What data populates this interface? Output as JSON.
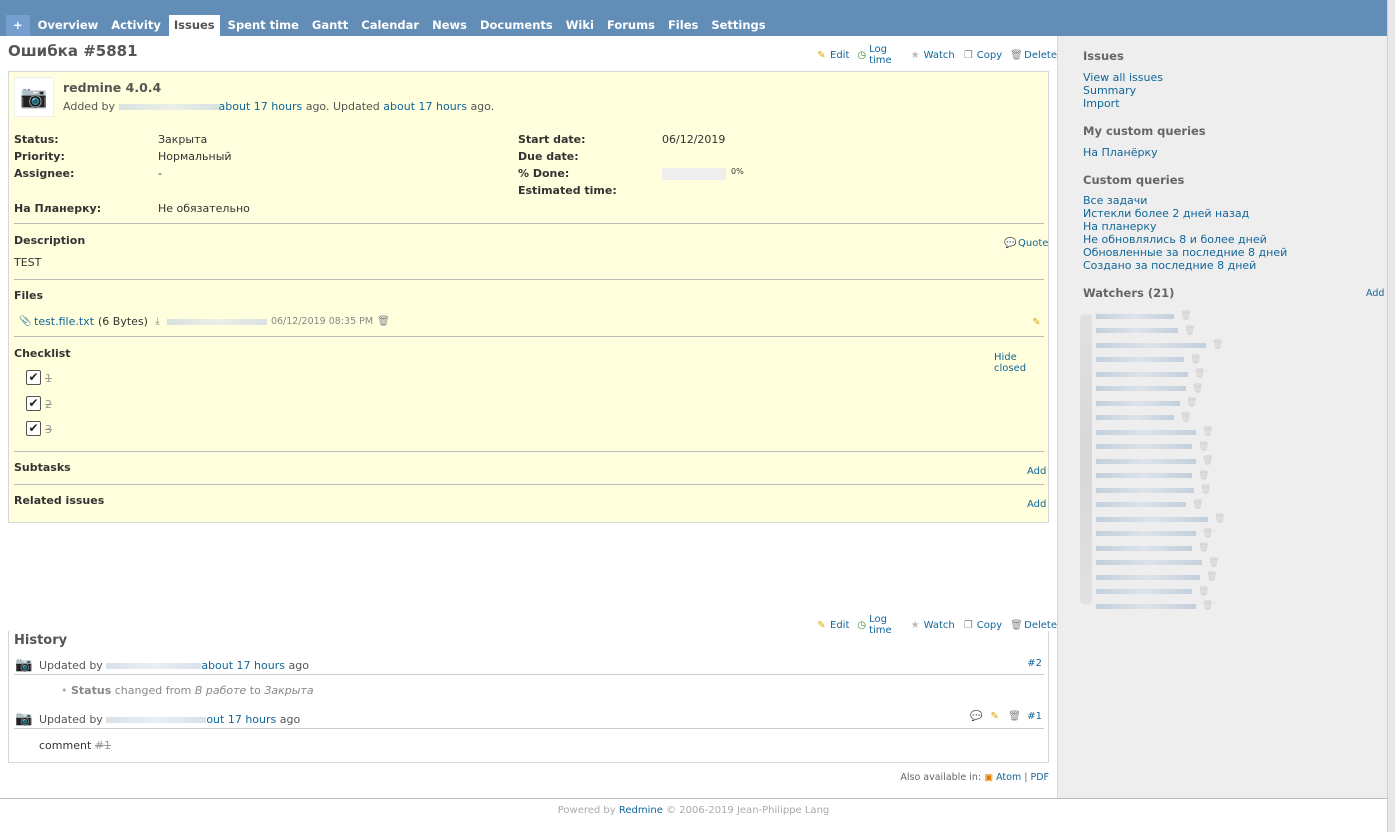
{
  "tabs": {
    "plus": "+",
    "items": [
      "Overview",
      "Activity",
      "Issues",
      "Spent time",
      "Gantt",
      "Calendar",
      "News",
      "Documents",
      "Wiki",
      "Forums",
      "Files",
      "Settings"
    ],
    "selected": "Issues"
  },
  "issue": {
    "title": "Ошибка #5881",
    "subject": "redmine 4.0.4",
    "added_by_prefix": "Added by",
    "added_ago": "about 17 hours",
    "updated_mid": "ago. Updated",
    "updated_ago": "about 17 hours",
    "ago_suffix": "ago.",
    "contextual": {
      "edit": "Edit",
      "log_time": "Log time",
      "watch": "Watch",
      "copy": "Copy",
      "delete": "Delete"
    },
    "attributes": {
      "status_label": "Status:",
      "status": "Закрыта",
      "priority_label": "Priority:",
      "priority": "Нормальный",
      "assignee_label": "Assignee:",
      "assignee": "-",
      "planerka_label": "На Планерку:",
      "planerka": "Не обязательно",
      "start_label": "Start date:",
      "start": "06/12/2019",
      "due_label": "Due date:",
      "due": "",
      "done_label": "% Done:",
      "done": "0%",
      "done_fraction": 0,
      "estimated_label": "Estimated time:",
      "estimated": ""
    },
    "description": {
      "heading": "Description",
      "quote": "Quote",
      "text": "TEST"
    },
    "files": {
      "heading": "Files",
      "name": "test.file.txt",
      "size": "(6 Bytes)",
      "date": "06/12/2019 08:35 PM"
    },
    "checklist": {
      "heading": "Checklist",
      "hide_closed": "Hide closed",
      "items": [
        "1",
        "2",
        "3"
      ]
    },
    "subtasks": {
      "heading": "Subtasks",
      "add": "Add"
    },
    "related": {
      "heading": "Related issues",
      "add": "Add"
    }
  },
  "history": {
    "title": "History",
    "journals": [
      {
        "prefix": "Updated by",
        "ago": "about 17 hours",
        "suffix": "ago",
        "num": "#2",
        "detail_field": "Status",
        "detail_mid": "changed from",
        "detail_old": "В работе",
        "detail_to": "to",
        "detail_new": "Закрыта"
      },
      {
        "prefix": "Updated by",
        "ago": "out 17 hours",
        "suffix": "ago",
        "num": "#1",
        "comment": "comment",
        "comment_ref": "#1"
      }
    ]
  },
  "also_available": {
    "label": "Also available in:",
    "atom": "Atom",
    "sep": "|",
    "pdf": "PDF"
  },
  "footer": {
    "powered": "Powered by",
    "redmine": "Redmine",
    "copyright": "© 2006-2019 Jean-Philippe Lang"
  },
  "sidebar": {
    "issues_heading": "Issues",
    "issue_links": [
      "View all issues",
      "Summary",
      "Import"
    ],
    "my_queries_heading": "My custom queries",
    "my_queries": [
      "На Планёрку"
    ],
    "custom_queries_heading": "Custom queries",
    "custom_queries": [
      "Все задачи",
      "Истекли более 2 дней назад",
      "На планерку",
      "Не обновлялись 8 и более дней",
      "Обновленные за последние 8 дней",
      "Создано за последние 8 дней"
    ],
    "watchers_heading": "Watchers (21)",
    "watchers_add": "Add"
  }
}
